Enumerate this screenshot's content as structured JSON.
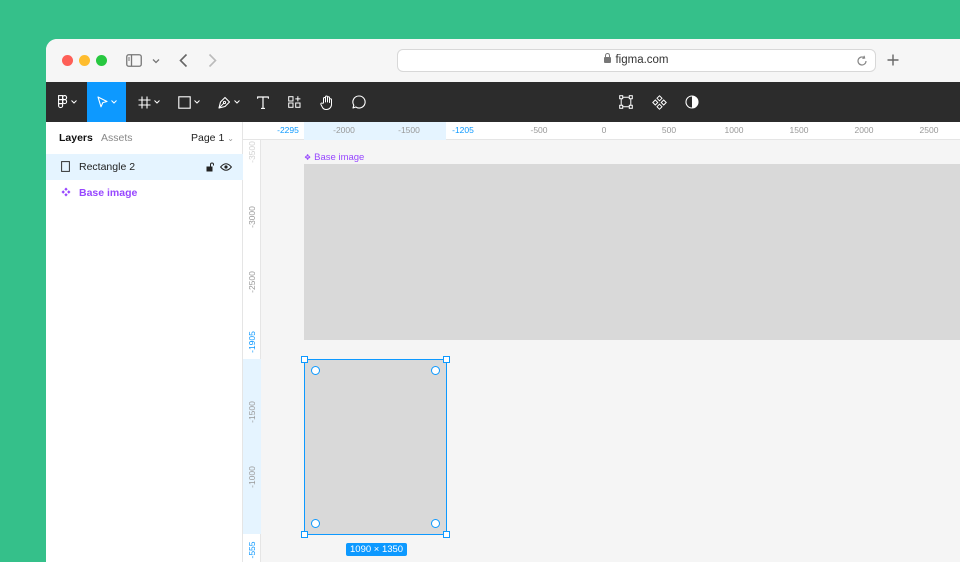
{
  "browser": {
    "url": "figma.com",
    "icons": [
      "sidebar-icon",
      "chevron-down-icon",
      "back-icon",
      "forward-icon",
      "lock-icon",
      "reload-icon",
      "new-tab-icon"
    ]
  },
  "toolbar": {
    "tools": [
      "figma-menu-icon",
      "move-icon",
      "frame-icon",
      "rectangle-icon",
      "pen-icon",
      "text-icon",
      "resources-icon",
      "hand-icon",
      "comment-icon"
    ],
    "center_tools": [
      "edit-object-icon",
      "component-icon",
      "mask-icon"
    ],
    "active_tool": "move",
    "accent": "#0d99ff"
  },
  "left_panel": {
    "tabs": [
      "Layers",
      "Assets"
    ],
    "page": "Page 1",
    "layers": [
      {
        "name": "Rectangle 2",
        "type": "rectangle",
        "selected": true
      },
      {
        "name": "Base image",
        "type": "component",
        "selected": false
      }
    ]
  },
  "rulers": {
    "top": [
      {
        "label": "-2295",
        "highlight": true
      },
      {
        "label": "-2000",
        "highlight": false
      },
      {
        "label": "-1500",
        "highlight": false
      },
      {
        "label": "-1205",
        "highlight": true
      },
      {
        "label": "-500",
        "highlight": false
      },
      {
        "label": "0",
        "highlight": false
      },
      {
        "label": "500",
        "highlight": false
      },
      {
        "label": "1000",
        "highlight": false
      },
      {
        "label": "1500",
        "highlight": false
      },
      {
        "label": "2000",
        "highlight": false
      },
      {
        "label": "2500",
        "highlight": false
      }
    ],
    "left": [
      {
        "label": "-3500",
        "highlight": false
      },
      {
        "label": "-3000",
        "highlight": false
      },
      {
        "label": "-2500",
        "highlight": false
      },
      {
        "label": "-1905",
        "highlight": true
      },
      {
        "label": "-1500",
        "highlight": false
      },
      {
        "label": "-1000",
        "highlight": false
      },
      {
        "label": "-555",
        "highlight": true
      }
    ]
  },
  "canvas": {
    "frame_label": "Base image",
    "selection_size": "1090 × 1350",
    "component_color": "#9747ff"
  }
}
